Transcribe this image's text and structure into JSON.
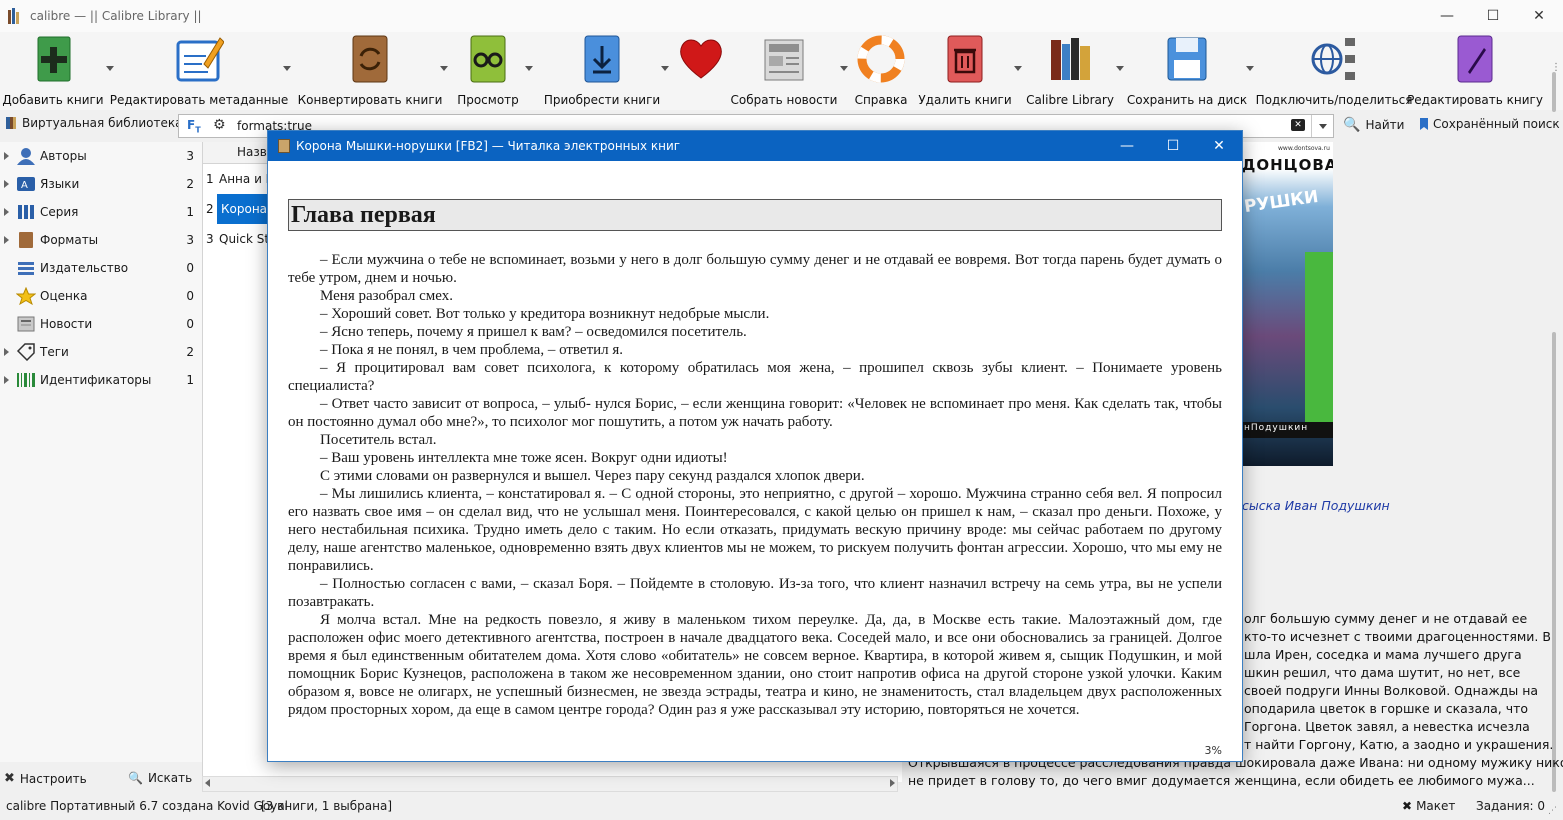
{
  "window": {
    "title": "calibre — || Calibre Library ||"
  },
  "toolbar": {
    "add": "Добавить книги",
    "edit_meta": "Редактировать метаданные",
    "convert": "Конвертировать книги",
    "view": "Просмотр",
    "get_books": "Приобрести книги",
    "news": "Собрать новости",
    "help": "Справка",
    "remove": "Удалить книги",
    "library": "Calibre Library",
    "save": "Сохранить на диск",
    "connect": "Подключить/поделиться",
    "edit_book": "Редактировать книгу"
  },
  "search": {
    "virtual_library": "Виртуальная библиотека",
    "query": "formats:true",
    "find": "Найти",
    "saved": "Сохранённый поиск"
  },
  "tag_browser": {
    "items": [
      {
        "label": "Авторы",
        "count": "3",
        "expandable": true
      },
      {
        "label": "Языки",
        "count": "2",
        "expandable": true
      },
      {
        "label": "Серия",
        "count": "1",
        "expandable": true
      },
      {
        "label": "Форматы",
        "count": "3",
        "expandable": true
      },
      {
        "label": "Издательство",
        "count": "0",
        "expandable": false
      },
      {
        "label": "Оценка",
        "count": "0",
        "expandable": false
      },
      {
        "label": "Новости",
        "count": "0",
        "expandable": false
      },
      {
        "label": "Теги",
        "count": "2",
        "expandable": true
      },
      {
        "label": "Идентификаторы",
        "count": "1",
        "expandable": true
      }
    ],
    "configure": "Настроить",
    "find": "Искать"
  },
  "book_list": {
    "header": "Назва",
    "rows": [
      {
        "num": "1",
        "title": "Анна и П"
      },
      {
        "num": "2",
        "title": "Корона М"
      },
      {
        "num": "3",
        "title": "Quick Sta"
      }
    ]
  },
  "cover": {
    "author_fragment": "ДОНЦОВА",
    "title_fragment": "РУШКИ",
    "site": "www.dontsova.ru",
    "series": "нПодушкин"
  },
  "details": {
    "series_link": "сыска Иван Подушкин",
    "lines": [
      "олг большую сумму денег и не отдавай ее",
      "кто-то исчезнет с твоими драгоценностями. В",
      "шла Ирен, соседка и мама лучшего друга",
      "шкин решил, что дама шутит, но нет, все",
      "своей подруги Инны Волковой. Однажды на",
      "оподарила цветок в горшке и сказала, что",
      "Горгона. Цветок завял, а невестка исчезла",
      "т найти Горгону, Катю, а заодно и украшения.",
      "Открывшаяся в процессе расследования правда шокировала даже Ивана: ни одному мужику никогда",
      "не придет в голову то, до чего вмиг додумается женщина, если обидеть ее любимого мужа..."
    ]
  },
  "status": {
    "left": "calibre Портативный 6.7 создана Kovid Goyal",
    "count": "[3 книги, 1 выбрана]",
    "layout": "Макет",
    "jobs": "Задания: 0"
  },
  "reader": {
    "title": "Корона Мышки-норушки [FB2] — Читалка электронных книг",
    "chapter": "Глава первая",
    "progress": "3%",
    "paragraphs": [
      "– Если мужчина о тебе не вспоминает, возьми у него в долг большую сумму денег и не отдавай ее вовремя. Вот тогда парень будет думать о тебе утром, днем и ночью.",
      "Меня разобрал смех.",
      "– Хороший совет. Вот только у кредитора возникнут недобрые мысли.",
      "– Ясно теперь, почему я пришел к вам? – осведомился посетитель.",
      "– Пока я не понял, в чем проблема, – ответил я.",
      "– Я процитировал вам совет психолога, к которому обратилась моя жена, – прошипел сквозь зубы клиент. – Понимаете уровень специалиста?",
      "– Ответ часто зависит от вопроса, – улыб- нулся Борис, – если женщина говорит: «Человек не вспоминает про меня. Как сделать так, чтобы он постоянно думал обо мне?», то психолог мог пошутить, а потом уж начать работу.",
      "Посетитель встал.",
      "– Ваш уровень интеллекта мне тоже ясен. Вокруг одни идиоты!",
      "С этими словами он развернулся и вышел. Через пару секунд раздался хлопок двери.",
      "– Мы лишились клиента, – констатировал я. – С одной стороны, это неприятно, с другой – хорошо. Мужчина странно себя вел. Я попросил его назвать свое имя – он сделал вид, что не услышал меня. Поинтересовался, с какой целью он пришел к нам, – сказал про деньги. Похоже, у него нестабильная психика. Трудно иметь дело с таким. Но если отказать, придумать вескую причину вроде: мы сейчас работаем по другому делу, наше агентство маленькое, одновременно взять двух клиентов мы не можем, то рискуем получить фонтан агрессии. Хорошо, что мы ему не понравились.",
      "– Полностью согласен с вами, – сказал Боря. – Пойдемте в столовую. Из-за того, что клиент назначил встречу на семь утра, вы не успели позавтракать.",
      "Я молча встал. Мне на редкость повезло, я живу в маленьком тихом переулке. Да, да, в Москве есть такие. Малоэтажный дом, где расположен офис моего детективного агентства, построен в начале двадцатого века. Соседей мало, и все они обосновались за границей. Долгое время я был единственным обитателем дома. Хотя слово «обитатель» не совсем верное. Квартира, в которой живем я, сыщик Подушкин, и мой помощник Борис Кузнецов, расположена в таком же несовременном здании, оно стоит напротив офиса на другой стороне узкой улочки. Каким образом я, вовсе не олигарх, не успешный бизнесмен, не звезда эстрады, театра и кино, не знаменитость, стал владельцем двух расположенных рядом просторных хором, да еще в самом центре города? Один раз я уже рассказывал эту историю, повторяться не хочется."
    ]
  }
}
